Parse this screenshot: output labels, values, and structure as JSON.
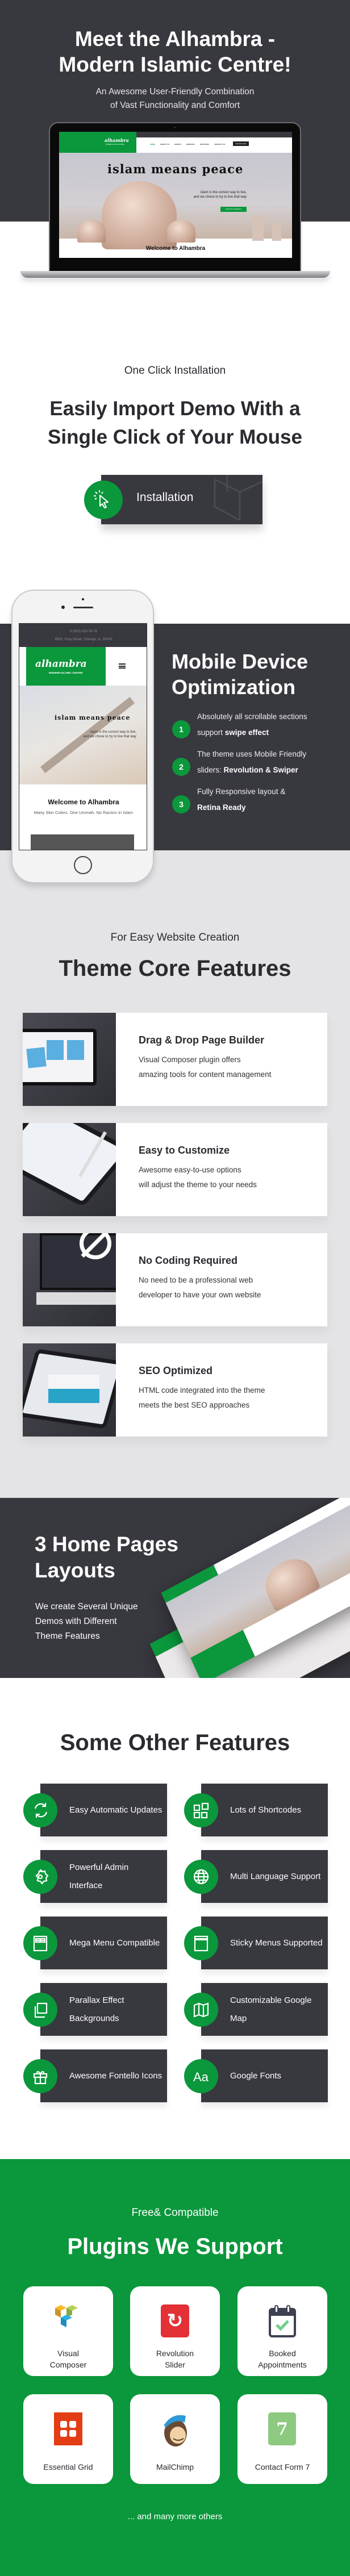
{
  "colors": {
    "dark": "#38383f",
    "green": "#0b973b",
    "light_gray": "#e4e4e6",
    "text": "#2a2a30"
  },
  "hero": {
    "title_line1": "Meet the Alhambra -",
    "title_line2": "Modern Islamic Centre!",
    "subtitle_line1": "An Awesome User-Friendly Combination",
    "subtitle_line2": "of Vast Functionality and Comfort",
    "mockup": {
      "logo": "alhambra",
      "logo_tagline": "MODERN ISLAMIC CENTRE",
      "nav": [
        "HOME",
        "ABOUT US",
        "EVENTS",
        "SERVICES",
        "FEATURES",
        "CONTACT US"
      ],
      "donate": "DONATE NOW",
      "script": "islam means peace",
      "text_line1": "islam is the correct way to live,",
      "text_line2": "and we chose to try to live that way",
      "join": "JOIN OUR COMMUNITY",
      "welcome": "Welcome to Alhambra"
    }
  },
  "install": {
    "eyebrow": "One Click Installation",
    "title_line1": "Easily Import Demo With a",
    "title_line2": "Single Click of Your Mouse",
    "button_label": "Installation",
    "button_icon": "cursor-click-icon"
  },
  "mobile": {
    "phone_screen": {
      "phone": "0 (800) 420-78-78",
      "address": "8500, Gray Street, Chicago, IL, 55030",
      "logo": "alhambra",
      "logo_tagline": "MODERN ISLAMIC CENTRE",
      "script": "islam means peace",
      "text_line1": "islam is the correct way to live,",
      "text_line2": "and we chose to try to live that way",
      "welcome": "Welcome to Alhambra",
      "tagline": "Many Skin Colors. One Ummah. No Racism in Islam"
    },
    "title_line1": "Mobile Device",
    "title_line2": "Optimization",
    "items": [
      {
        "num": "1",
        "line1": "Absolutely all scrollable sections",
        "pre": "support ",
        "bold": "swipe effect"
      },
      {
        "num": "2",
        "line1": "The theme uses Mobile Friendly",
        "pre": "sliders: ",
        "bold": "Revolution & Swiper"
      },
      {
        "num": "3",
        "line1": "Fully Responsive layout &",
        "pre": "",
        "bold": "Retina Ready"
      }
    ]
  },
  "core": {
    "eyebrow": "For Easy Website Creation",
    "title": "Theme Core Features",
    "cards": [
      {
        "title": "Drag & Drop Page Builder",
        "line1": "Visual Composer plugin offers",
        "line2": "amazing tools for content management",
        "image": "page-builder"
      },
      {
        "title": "Easy to Customize",
        "line1": "Awesome easy-to-use options",
        "line2": "will adjust the theme to your needs",
        "image": "tablet-admin"
      },
      {
        "title": "No Coding Required",
        "line1": "No need to be a professional web",
        "line2": "developer to have your own website",
        "image": "no-code"
      },
      {
        "title": "SEO Optimized",
        "line1": "HTML code integrated into the theme",
        "line2": "meets the best SEO approaches",
        "image": "seo-tablet"
      }
    ]
  },
  "layouts": {
    "title_line1": "3 Home Pages",
    "title_line2": "Layouts",
    "desc_line1": "We create Several Unique",
    "desc_line2": "Demos with Different",
    "desc_line3": "Theme Features"
  },
  "other": {
    "title": "Some Other Features",
    "tiles": [
      {
        "label": "Easy Automatic Updates",
        "icon": "refresh"
      },
      {
        "label": "Lots of Shortcodes",
        "icon": "shortcodes"
      },
      {
        "label": "Powerful Admin Interface",
        "icon": "gear"
      },
      {
        "label": "Multi Language Support",
        "icon": "globe"
      },
      {
        "label": "Mega Menu Compatible",
        "icon": "mega-menu"
      },
      {
        "label": "Sticky Menus Supported",
        "icon": "sticky-menu"
      },
      {
        "label": "Parallax Effect Backgrounds",
        "icon": "layers"
      },
      {
        "label": "Customizable Google Map",
        "icon": "map"
      },
      {
        "label": "Awesome Fontello Icons",
        "icon": "gift"
      },
      {
        "label": "Google Fonts",
        "icon": "font"
      }
    ]
  },
  "plugins": {
    "eyebrow": "Free& Compatible",
    "title": "Plugins We Support",
    "items": [
      {
        "label": "Visual Composer",
        "icon": "visual-composer"
      },
      {
        "label": "Revolution Slider",
        "icon": "revolution-slider"
      },
      {
        "label": "Booked Appointments",
        "icon": "booked"
      },
      {
        "label": "Essential Grid",
        "icon": "essential-grid"
      },
      {
        "label": "MailChimp",
        "icon": "mailchimp"
      },
      {
        "label": "Contact Form 7",
        "icon": "contact-form-7"
      }
    ],
    "footer": "... and many more others"
  }
}
